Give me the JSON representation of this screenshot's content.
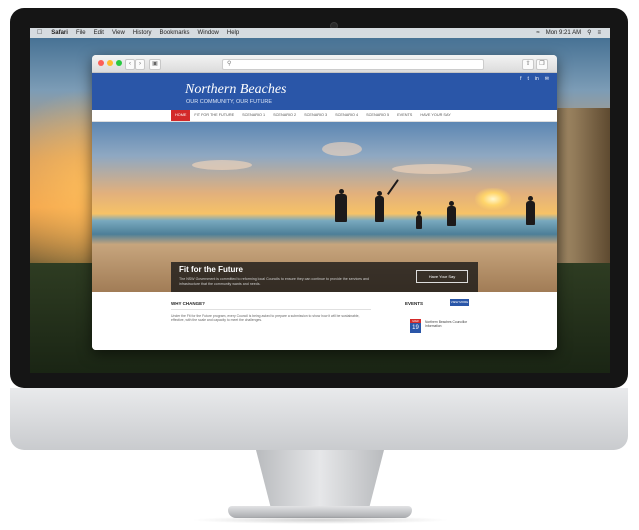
{
  "desktop": {
    "menubar": {
      "app_name": "Safari",
      "items": [
        "File",
        "Edit",
        "View",
        "History",
        "Bookmarks",
        "Window",
        "Help"
      ],
      "clock": "Mon 9:21 AM"
    }
  },
  "browser": {
    "buttons": {
      "back": "‹",
      "forward": "›"
    }
  },
  "site": {
    "title": "Northern Beaches",
    "tagline": "OUR COMMUNITY, OUR FUTURE",
    "social": [
      "f",
      "t",
      "in",
      "✉"
    ],
    "nav": [
      "HOME",
      "FIT FOR THE FUTURE",
      "SCENARIO 1",
      "SCENARIO 2",
      "SCENARIO 3",
      "SCENARIO 4",
      "SCENARIO 5",
      "EVENTS",
      "HAVE YOUR SAY"
    ],
    "hero": {
      "title": "Fit for the Future",
      "text": "The NSW Government is committed to reforming local Councils to ensure they can continue to provide the services and infrastructure that the community wants and needs.",
      "button": "Have Your Say"
    },
    "why": {
      "title": "WHY CHANGE?",
      "text": "Under the Fit for the Future program, every Council is being asked to prepare a submission to show how it will be sustainable, effective, with the scale and capacity to meet the challenges."
    },
    "events": {
      "title": "EVENTS",
      "view_all": "VIEW MORE",
      "items": [
        {
          "month": "MAR",
          "day": "19",
          "text": "Northern Beaches Councillor Information"
        }
      ]
    }
  },
  "colors": {
    "brand_blue": "#2a56a8",
    "active_red": "#d32a2a",
    "traffic_red": "#fc5f57",
    "traffic_yellow": "#fdbc2e",
    "traffic_green": "#28c840"
  }
}
